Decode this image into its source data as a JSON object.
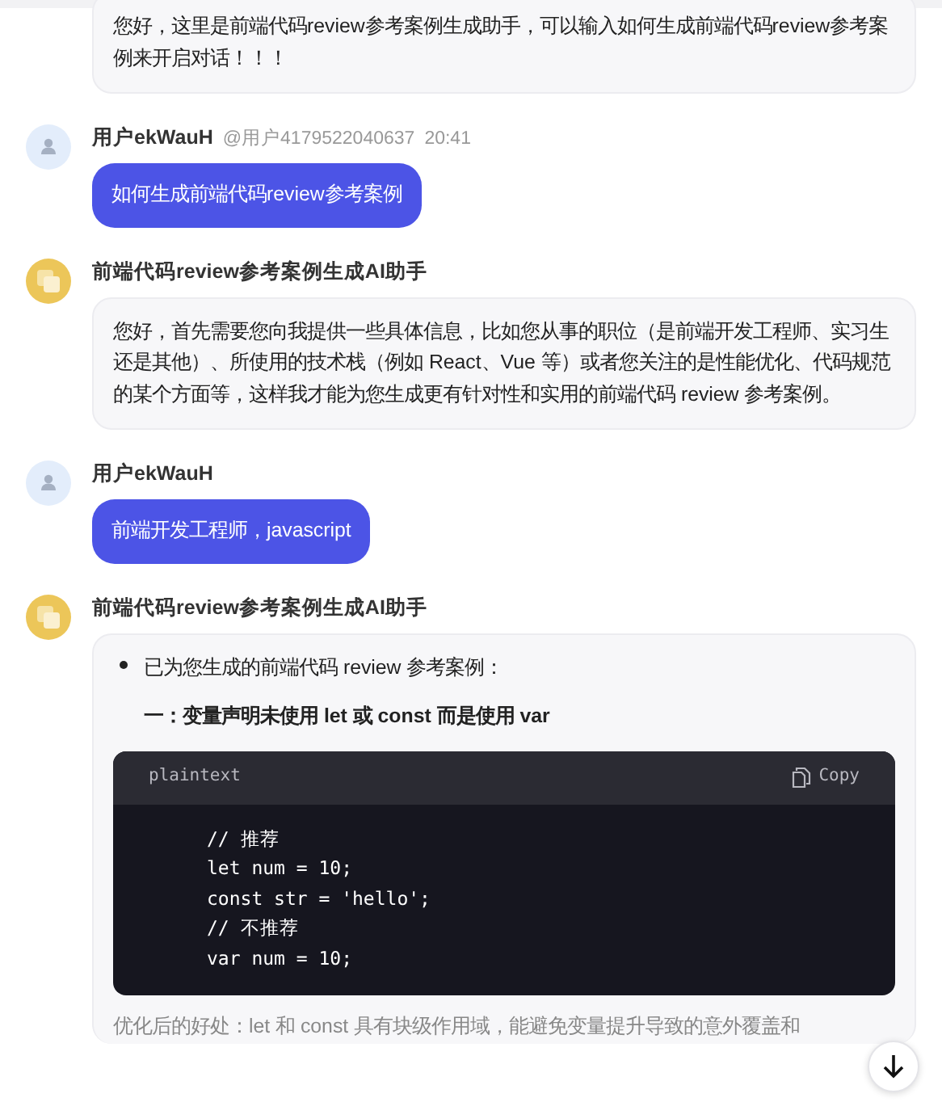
{
  "messages": [
    {
      "kind": "assistant",
      "text": "您好，这里是前端代码review参考案例生成助手，可以输入如何生成前端代码review参考案例来开启对话！！！"
    },
    {
      "kind": "user",
      "name": "用户ekWauH",
      "handle": "@用户4179522040637",
      "time": "20:41",
      "text": "如何生成前端代码review参考案例"
    },
    {
      "kind": "assistant",
      "name": "前端代码review参考案例生成AI助手",
      "text": "您好，首先需要您向我提供一些具体信息，比如您从事的职位（是前端开发工程师、实习生还是其他）、所使用的技术栈（例如 React、Vue 等）或者您关注的是性能优化、代码规范的某个方面等，这样我才能为您生成更有针对性和实用的前端代码 review 参考案例。"
    },
    {
      "kind": "user",
      "name": "用户ekWauH",
      "text": "前端开发工程师，javascript"
    },
    {
      "kind": "assistant",
      "name": "前端代码review参考案例生成AI助手",
      "blocks": [
        {
          "kind": "bullet",
          "text": "已为您生成的前端代码 review 参考案例："
        },
        {
          "kind": "heading",
          "text": "一：变量声明未使用 let 或 const 而是使用 var"
        },
        {
          "kind": "code",
          "language": "plaintext",
          "copy": "Copy",
          "lines": [
            "// 推荐",
            "let num = 10;",
            "const str = 'hello';",
            "// 不推荐",
            "var num = 10;"
          ]
        },
        {
          "kind": "paragraph",
          "text": "优化后的好处：let 和 const 具有块级作用域，能避免变量提升导致的意外覆盖和"
        }
      ]
    }
  ]
}
